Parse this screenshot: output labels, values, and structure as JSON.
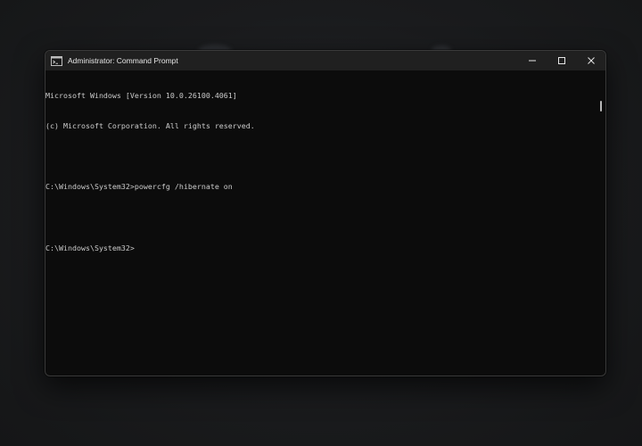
{
  "window": {
    "title": "Administrator: Command Prompt",
    "app_icon": "command-prompt-icon",
    "controls": {
      "minimize_icon": "minimize-icon",
      "maximize_icon": "maximize-icon",
      "close_icon": "close-icon"
    }
  },
  "console": {
    "lines": [
      "Microsoft Windows [Version 10.0.26100.4061]",
      "(c) Microsoft Corporation. All rights reserved.",
      "",
      "C:\\Windows\\System32>powercfg /hibernate on",
      "",
      "C:\\Windows\\System32>"
    ]
  },
  "colors": {
    "console_background": "#0c0c0c",
    "console_text": "#cccccc",
    "titlebar_background": "#202020",
    "title_text": "#e6e6e6"
  }
}
